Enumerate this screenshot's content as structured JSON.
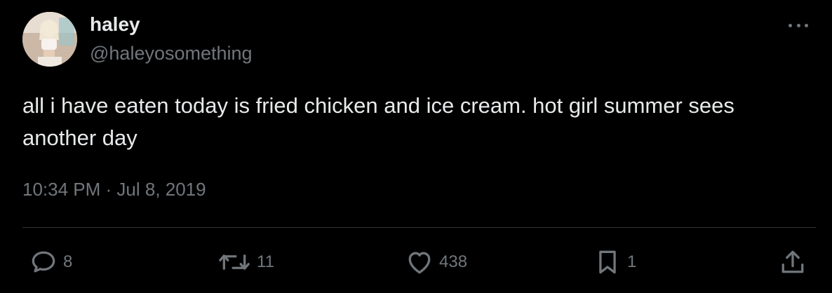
{
  "author": {
    "display_name": "haley",
    "handle": "@haleyosomething"
  },
  "tweet": {
    "text": "all i have eaten today is fried chicken and ice cream. hot girl summer sees another day",
    "timestamp": "10:34 PM · Jul 8, 2019"
  },
  "actions": {
    "replies": "8",
    "retweets": "11",
    "likes": "438",
    "bookmarks": "1"
  },
  "icons": {
    "more": "more-icon",
    "reply": "reply-icon",
    "retweet": "retweet-icon",
    "like": "heart-icon",
    "bookmark": "bookmark-icon",
    "share": "share-icon"
  },
  "colors": {
    "background": "#000000",
    "text_primary": "#e7e9ea",
    "text_secondary": "#71767b",
    "divider": "#2f3336"
  }
}
